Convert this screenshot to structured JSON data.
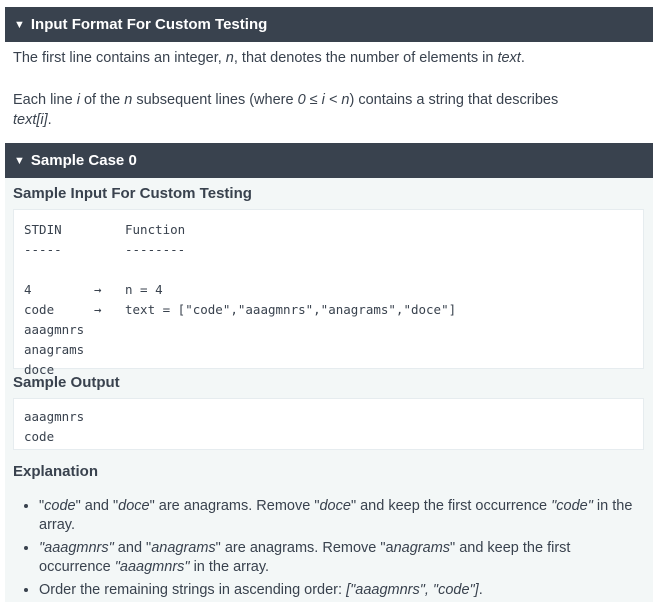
{
  "input_format": {
    "header": "Input Format For Custom Testing",
    "para1": [
      {
        "t": "The first line contains an integer, "
      },
      {
        "t": "n",
        "i": true
      },
      {
        "t": ", that denotes the number of elements in "
      },
      {
        "t": "text",
        "i": true
      },
      {
        "t": "."
      }
    ],
    "para2a": [
      {
        "t": "Each line "
      },
      {
        "t": "i",
        "i": true
      },
      {
        "t": " of the "
      },
      {
        "t": "n",
        "i": true
      },
      {
        "t": " subsequent lines (where "
      },
      {
        "t": "0 ≤ i < n",
        "i": true
      },
      {
        "t": ") contains a string that describes"
      }
    ],
    "para2b": [
      {
        "t": "text[i]",
        "i": true
      },
      {
        "t": "."
      }
    ]
  },
  "sample_case": {
    "header": "Sample Case 0",
    "input_title": "Sample Input For Custom Testing",
    "input_lines": [
      {
        "left": "STDIN",
        "arrow": "",
        "right": "Function"
      },
      {
        "left": "-----",
        "arrow": "",
        "right": "--------"
      },
      {
        "left": "",
        "arrow": "",
        "right": ""
      },
      {
        "left": "4",
        "arrow": "→",
        "right": "n = 4"
      },
      {
        "left": "code",
        "arrow": "→",
        "right": "text = [\"code\",\"aaagmnrs\",\"anagrams\",\"doce\"]"
      },
      {
        "left": "aaagmnrs",
        "arrow": "",
        "right": ""
      },
      {
        "left": "anagrams",
        "arrow": "",
        "right": ""
      },
      {
        "left": "doce",
        "arrow": "",
        "right": ""
      }
    ],
    "output_title": "Sample Output",
    "output_lines": [
      "aaagmnrs",
      "code"
    ],
    "explanation_title": "Explanation",
    "explanation": [
      {
        "line1": [
          {
            "t": "\""
          },
          {
            "t": "code",
            "i": true
          },
          {
            "t": "\" and \""
          },
          {
            "t": "doce",
            "i": true
          },
          {
            "t": "\" are anagrams. Remove \""
          },
          {
            "t": "doce",
            "i": true
          },
          {
            "t": "\" and keep the first occurrence "
          },
          {
            "t": "\"code\"",
            "i": true
          },
          {
            "t": " in the"
          }
        ],
        "line2": [
          {
            "t": "array."
          }
        ]
      },
      {
        "line1": [
          {
            "t": "\"aaagmnrs\"",
            "i": true
          },
          {
            "t": " and \""
          },
          {
            "t": "anagrams",
            "i": true
          },
          {
            "t": "\" are anagrams. Remove \"a"
          },
          {
            "t": "nagrams",
            "i": true
          },
          {
            "t": "\" and keep the first"
          }
        ],
        "line2": [
          {
            "t": "occurrence "
          },
          {
            "t": "\"aaagmnrs\"",
            "i": true
          },
          {
            "t": " in the array."
          }
        ]
      },
      {
        "line1": [
          {
            "t": "Order the remaining strings in ascending order:  "
          },
          {
            "t": "[\"aaagmnrs\", \"code\"]",
            "i": true
          },
          {
            "t": "."
          }
        ],
        "line2": []
      }
    ]
  }
}
